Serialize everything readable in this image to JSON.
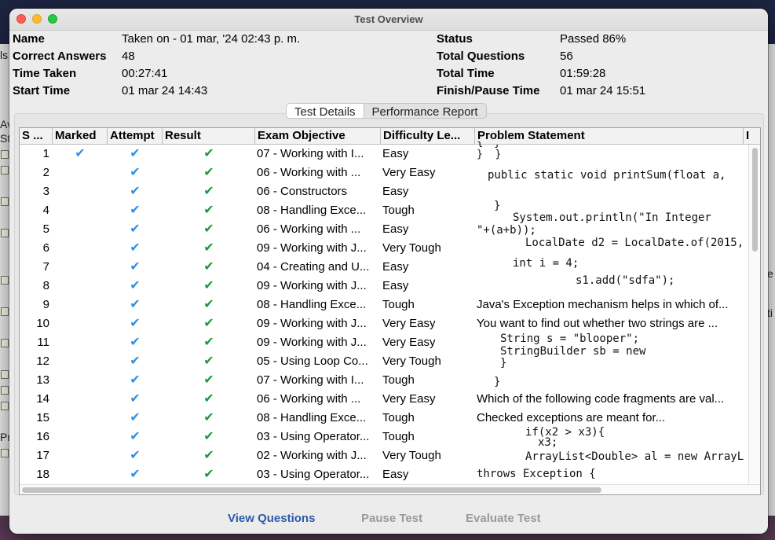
{
  "window": {
    "title": "Test Overview"
  },
  "info": {
    "name_label": "Name",
    "name_value": "Taken on - 01 mar, '24 02:43 p. m.",
    "correct_label": "Correct Answers",
    "correct_value": "48",
    "time_taken_label": "Time Taken",
    "time_taken_value": "00:27:41",
    "start_label": "Start Time",
    "start_value": "01 mar 24 14:43",
    "status_label": "Status",
    "status_value": "Passed 86%",
    "total_q_label": "Total Questions",
    "total_q_value": "56",
    "total_time_label": "Total Time",
    "total_time_value": "01:59:28",
    "finish_label": "Finish/Pause Time",
    "finish_value": "01 mar 24 15:51"
  },
  "tabs": {
    "details": "Test Details",
    "performance": "Performance Report"
  },
  "columns": [
    "S ...",
    "Marked",
    "Attempt",
    "Result",
    "Exam Objective",
    "Difficulty Le...",
    "Problem Statement",
    "I"
  ],
  "check_glyph": "✔",
  "rows": [
    {
      "sn": "1",
      "marked": true,
      "objective": "07 - Working with I...",
      "difficulty": "Easy"
    },
    {
      "sn": "2",
      "marked": false,
      "objective": "06 - Working with ...",
      "difficulty": "Very Easy"
    },
    {
      "sn": "3",
      "marked": false,
      "objective": "06 - Constructors",
      "difficulty": "Easy"
    },
    {
      "sn": "4",
      "marked": false,
      "objective": "08 - Handling Exce...",
      "difficulty": "Tough"
    },
    {
      "sn": "5",
      "marked": false,
      "objective": "06 - Working with ...",
      "difficulty": "Easy"
    },
    {
      "sn": "6",
      "marked": false,
      "objective": "09 - Working with J...",
      "difficulty": "Very Tough"
    },
    {
      "sn": "7",
      "marked": false,
      "objective": "04 - Creating and U...",
      "difficulty": "Easy"
    },
    {
      "sn": "8",
      "marked": false,
      "objective": "09 - Working with J...",
      "difficulty": "Easy"
    },
    {
      "sn": "9",
      "marked": false,
      "objective": "08 - Handling Exce...",
      "difficulty": "Tough"
    },
    {
      "sn": "10",
      "marked": false,
      "objective": "09 - Working with J...",
      "difficulty": "Very Easy"
    },
    {
      "sn": "11",
      "marked": false,
      "objective": "09 - Working with J...",
      "difficulty": "Very Easy"
    },
    {
      "sn": "12",
      "marked": false,
      "objective": "05 - Using Loop Co...",
      "difficulty": "Very Tough"
    },
    {
      "sn": "13",
      "marked": false,
      "objective": "07 - Working with I...",
      "difficulty": "Tough"
    },
    {
      "sn": "14",
      "marked": false,
      "objective": "06 - Working with ...",
      "difficulty": "Very Easy"
    },
    {
      "sn": "15",
      "marked": false,
      "objective": "08 - Handling Exce...",
      "difficulty": "Tough"
    },
    {
      "sn": "16",
      "marked": false,
      "objective": "03 - Using Operator...",
      "difficulty": "Tough"
    },
    {
      "sn": "17",
      "marked": false,
      "objective": "02 - Working with J...",
      "difficulty": "Very Tough"
    },
    {
      "sn": "18",
      "marked": false,
      "objective": "03 - Using Operator...",
      "difficulty": "Easy"
    }
  ],
  "problem": {
    "p1a": "}",
    "p1b": "}  }",
    "p2": "public static void printSum(float a,",
    "p4": "}",
    "p5a": "System.out.println(\"In Integer",
    "p5b": "\"+(a+b));",
    "p6": "LocalDate d2 = LocalDate.of(2015,",
    "p7": "int i = 4;",
    "p8": "s1.add(\"sdfa\");",
    "p9": "Java's Exception mechanism helps in which of...",
    "p10": "You want to find out whether two strings are ...",
    "p11a": "String s = \"blooper\";",
    "p11b": "StringBuilder sb = new",
    "p12": "}",
    "p13": "}",
    "p14": "Which of the following code fragments are val...",
    "p15": "Checked exceptions are meant for...",
    "p16a": "if(x2 > x3){",
    "p16b": "x3;",
    "p17": "ArrayList<Double> al = new ArrayLis",
    "p18": "throws Exception {"
  },
  "buttons": {
    "view": "View Questions",
    "pause": "Pause Test",
    "evaluate": "Evaluate Test"
  },
  "background": {
    "left_fragments": [
      "ls",
      "Av",
      "St",
      "Pr"
    ],
    "right_fragments": [
      "e",
      "ti"
    ]
  }
}
